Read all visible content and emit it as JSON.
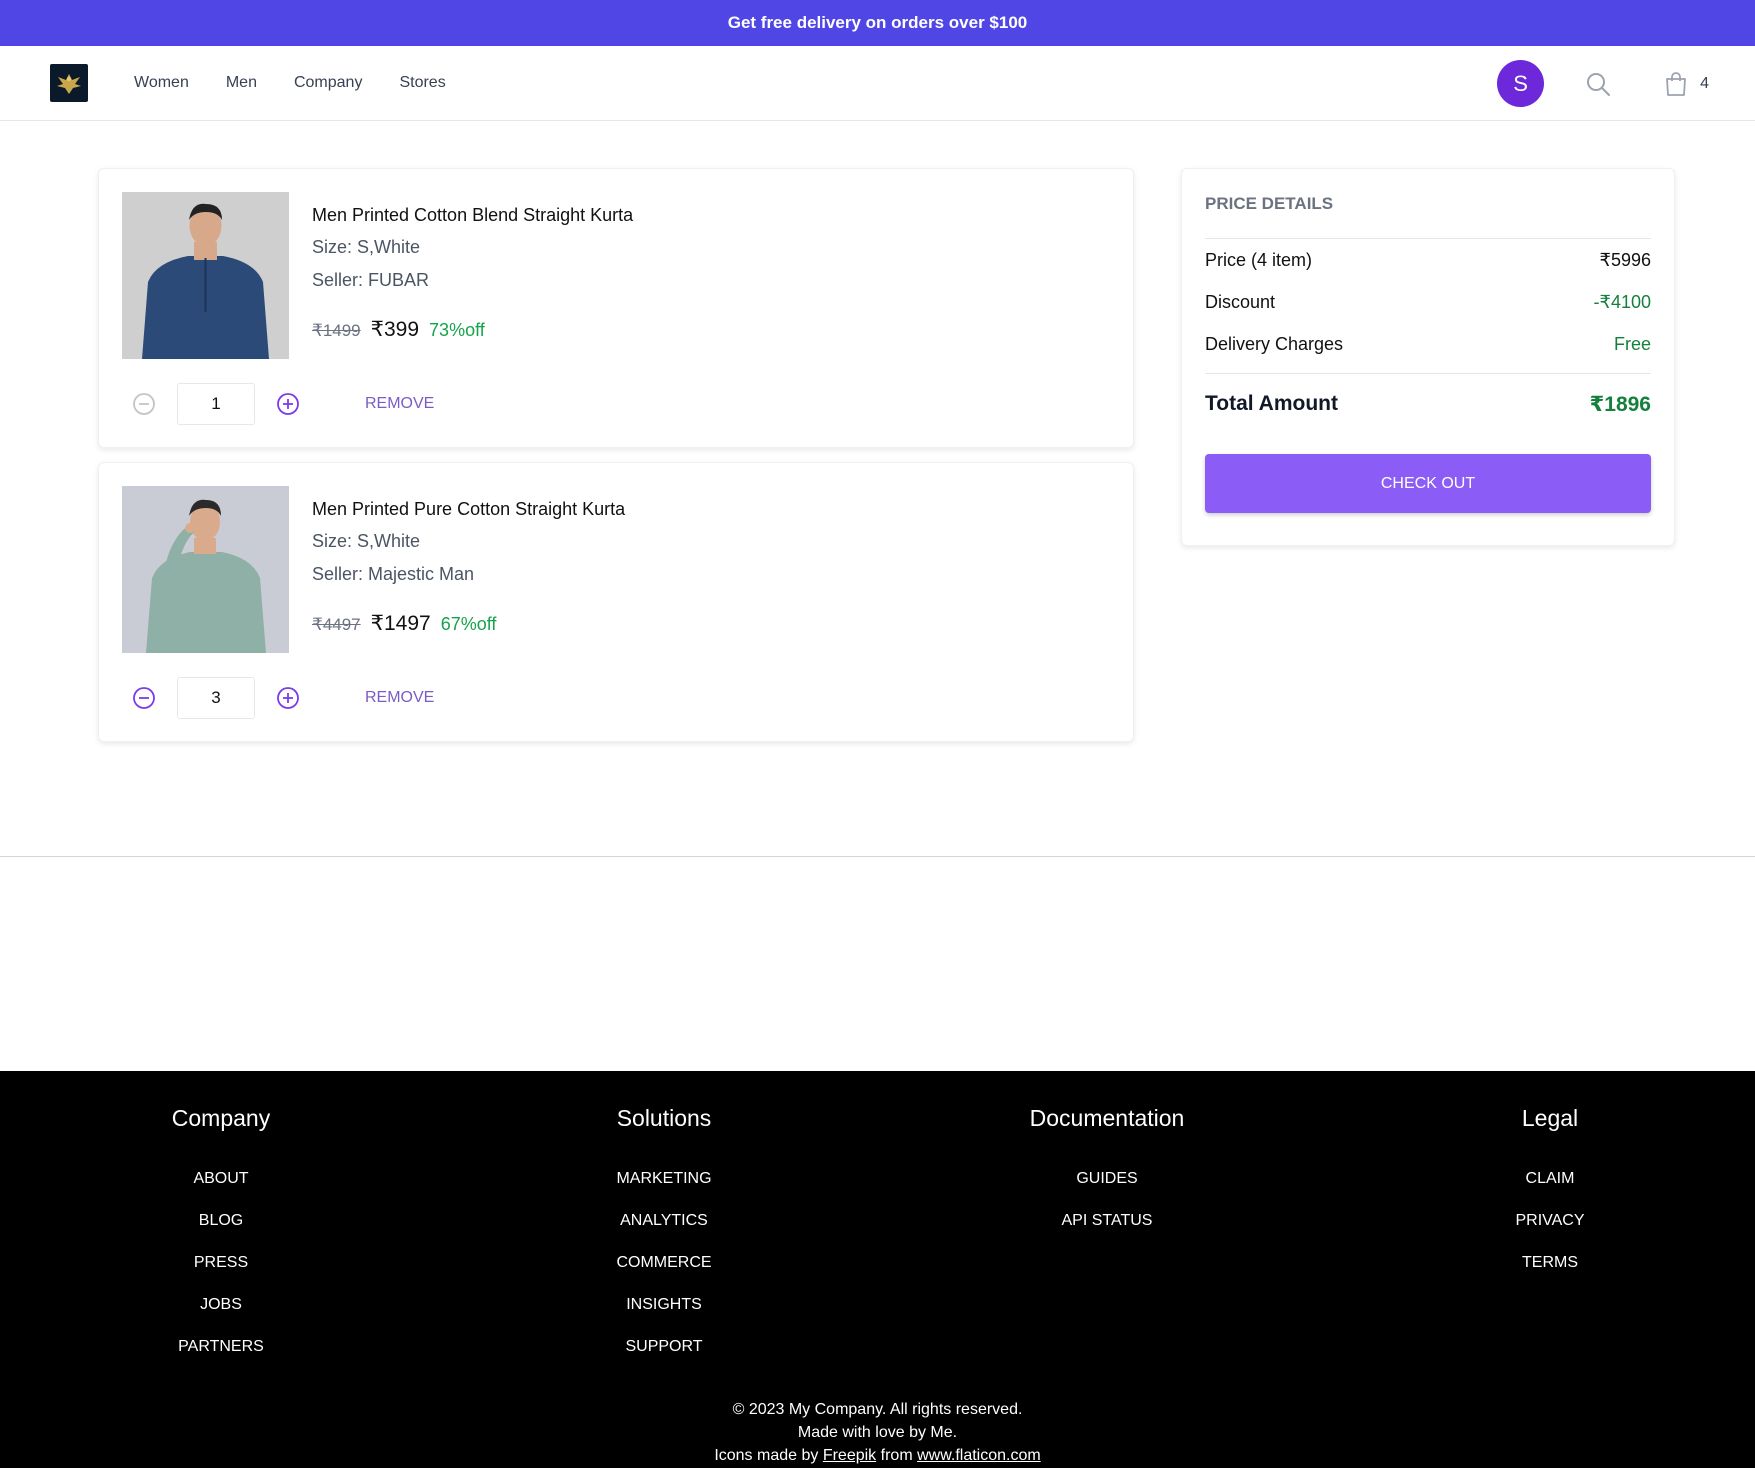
{
  "promo": {
    "text": "Get free delivery on orders over $100"
  },
  "nav": {
    "links": [
      "Women",
      "Men",
      "Company",
      "Stores"
    ],
    "avatar_initial": "S",
    "cart_count": "4"
  },
  "cart": {
    "items": [
      {
        "title": "Men Printed Cotton Blend Straight Kurta",
        "size": "Size: S,White",
        "seller": "Seller: FUBAR",
        "mrp": "₹1499",
        "price": "₹399",
        "discount": "73%off",
        "quantity": "1",
        "remove_label": "REMOVE",
        "shirt_color": "#2b4a78"
      },
      {
        "title": "Men Printed Pure Cotton Straight Kurta",
        "size": "Size: S,White",
        "seller": "Seller: Majestic Man",
        "mrp": "₹4497",
        "price": "₹1497",
        "discount": "67%off",
        "quantity": "3",
        "remove_label": "REMOVE",
        "shirt_color": "#8fb0a6"
      }
    ]
  },
  "price_details": {
    "title": "PRICE DETAILS",
    "price_label": "Price (4 item)",
    "price_value": "₹5996",
    "discount_label": "Discount",
    "discount_value": "-₹4100",
    "delivery_label": "Delivery Charges",
    "delivery_value": "Free",
    "total_label": "Total Amount",
    "total_value": "₹1896",
    "checkout_label": "CHECK OUT"
  },
  "footer": {
    "columns": [
      {
        "heading": "Company",
        "links": [
          "ABOUT",
          "BLOG",
          "PRESS",
          "JOBS",
          "PARTNERS"
        ]
      },
      {
        "heading": "Solutions",
        "links": [
          "MARKETING",
          "ANALYTICS",
          "COMMERCE",
          "INSIGHTS",
          "SUPPORT"
        ]
      },
      {
        "heading": "Documentation",
        "links": [
          "GUIDES",
          "API STATUS"
        ]
      },
      {
        "heading": "Legal",
        "links": [
          "CLAIM",
          "PRIVACY",
          "TERMS"
        ]
      }
    ],
    "copyright": "© 2023 My Company. All rights reserved.",
    "made_with": "Made with love by Me.",
    "credit_prefix": "Icons made by",
    "credit_author": "Freepik",
    "credit_mid": "from",
    "credit_site": "www.flaticon.com"
  },
  "colors": {
    "brand": "#4f46e5",
    "checkout": "#8b5cf6",
    "success": "#16a34a"
  }
}
